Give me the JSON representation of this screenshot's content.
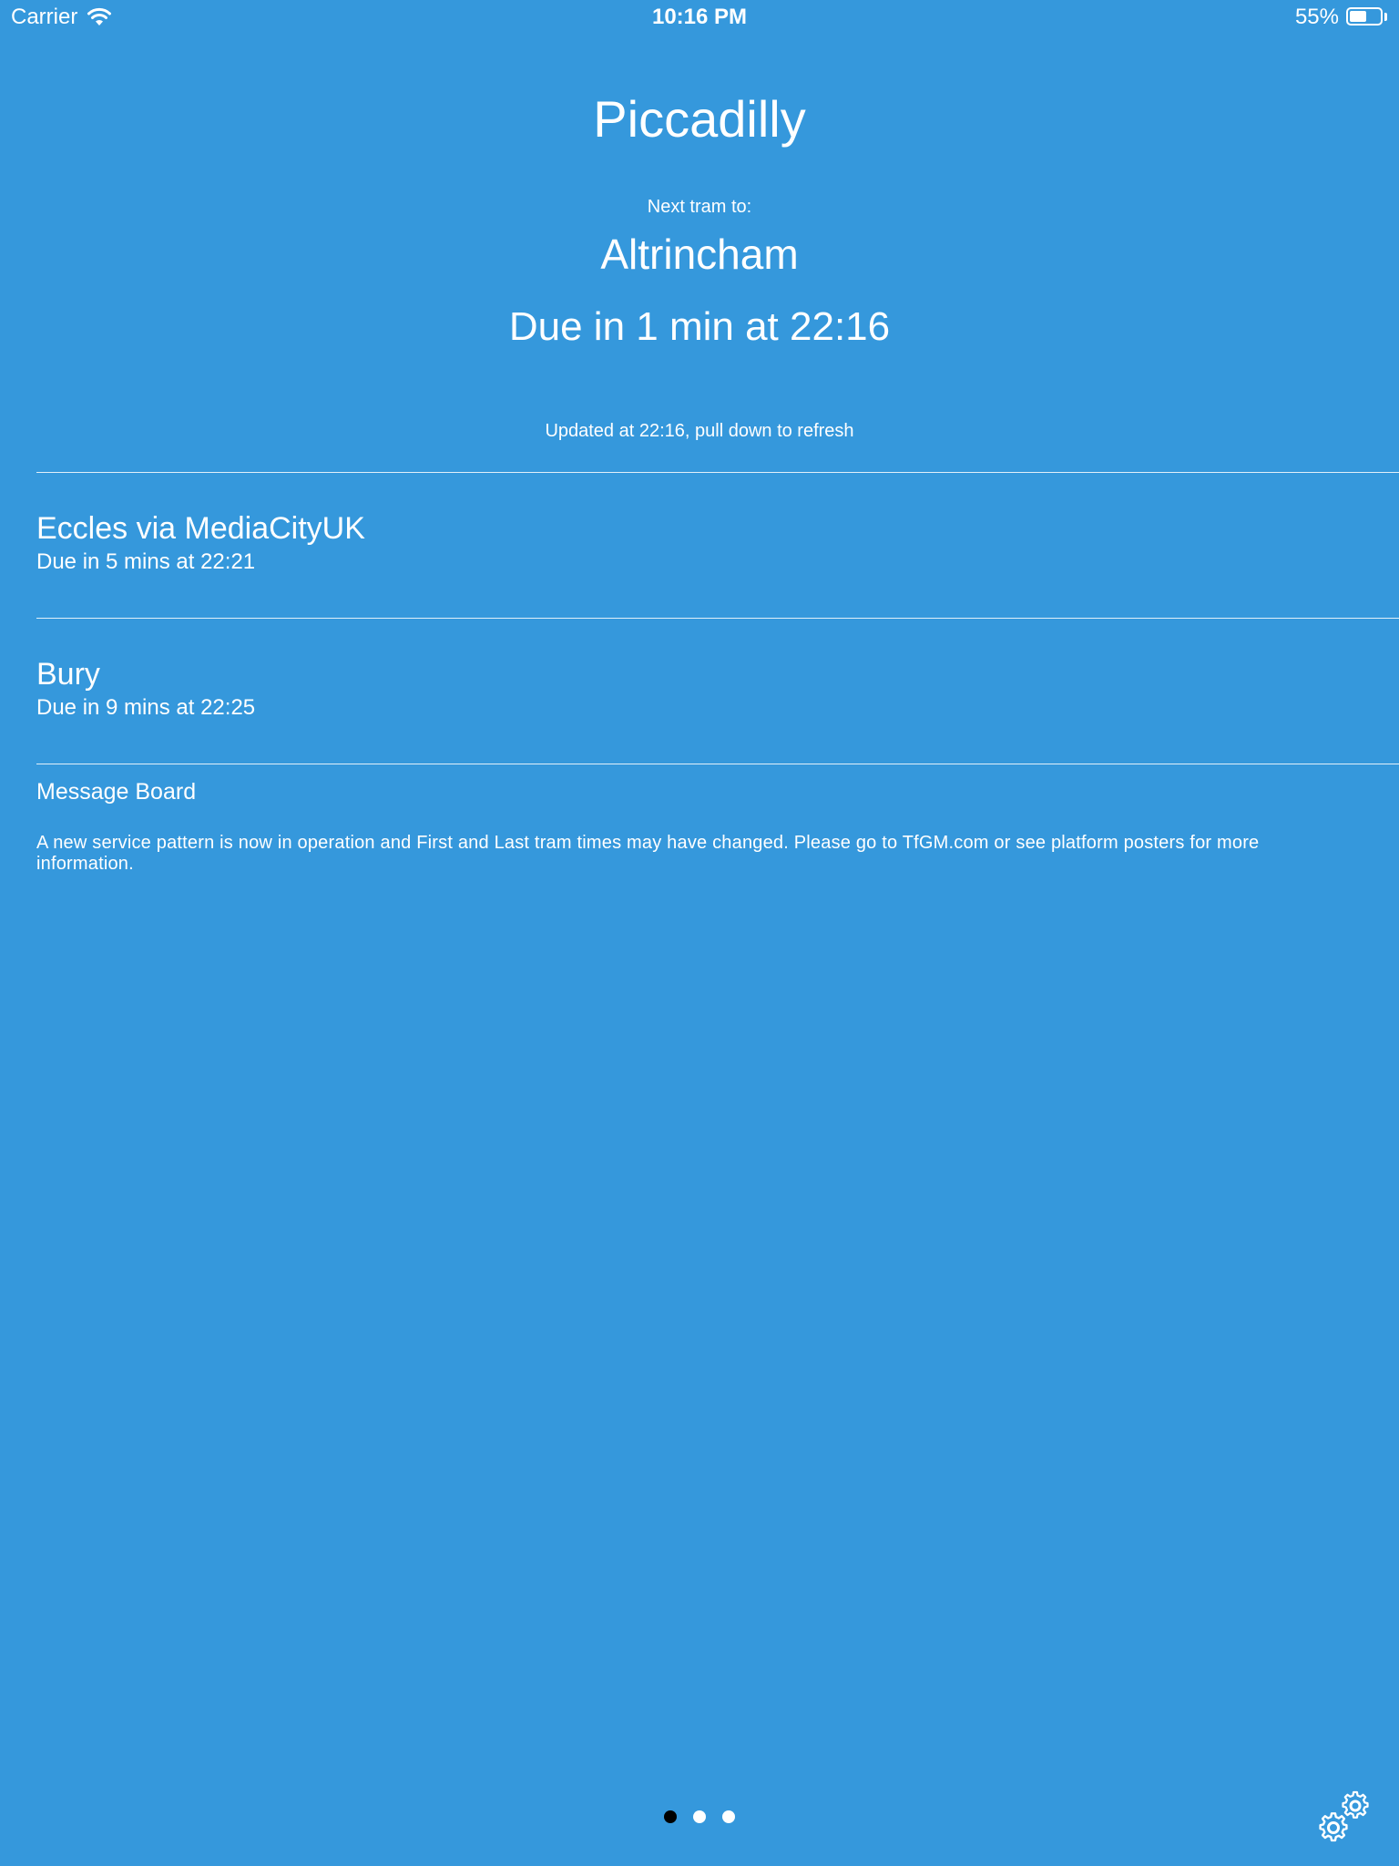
{
  "status_bar": {
    "carrier": "Carrier",
    "time": "10:16 PM",
    "battery_text": "55%",
    "battery_level": 0.55
  },
  "station": {
    "name": "Piccadilly"
  },
  "next_tram": {
    "label": "Next tram to:",
    "destination": "Altrincham",
    "due": "Due in 1 min at 22:16"
  },
  "updated_text": "Updated at 22:16, pull down to refresh",
  "departures": [
    {
      "destination": "Eccles via MediaCityUK",
      "due": "Due in 5 mins at 22:21"
    },
    {
      "destination": "Bury",
      "due": "Due in 9 mins at 22:25"
    }
  ],
  "message_board": {
    "title": "Message Board",
    "text": "A new service pattern is now in operation and First and Last tram times may have changed. Please go to TfGM.com or see platform posters for more information."
  },
  "pager": {
    "count": 3,
    "active_index": 0
  },
  "icons": {
    "wifi": "wifi-icon",
    "battery": "battery-icon",
    "settings": "gear-icon"
  },
  "colors": {
    "background": "#3598dc",
    "text": "#ffffff",
    "active_dot": "#000000"
  }
}
